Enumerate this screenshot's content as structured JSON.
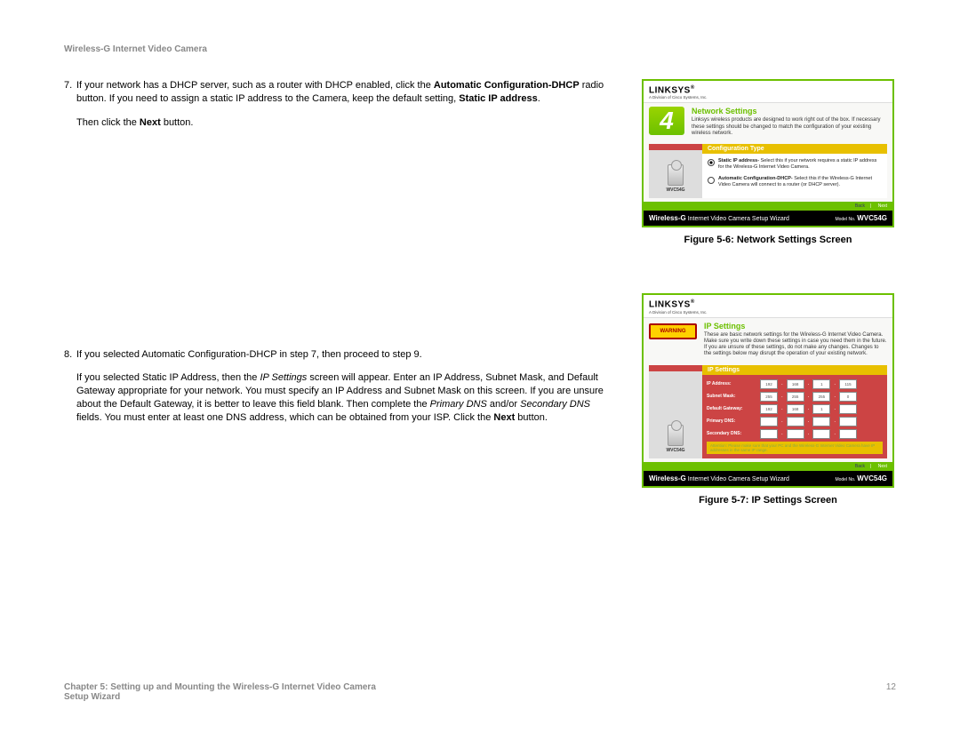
{
  "header": "Wireless-G Internet Video Camera",
  "steps": {
    "s7": {
      "num": "7.",
      "line1_a": "If your network has a DHCP server, such as a router with DHCP enabled, click the ",
      "line1_b": "Automatic Configuration-DHCP",
      "line1_c": " radio button. If you need to assign a static IP address to the Camera, keep the default setting, ",
      "line1_d": "Static IP address",
      "line1_e": ".",
      "line2_a": "Then click the ",
      "line2_b": "Next",
      "line2_c": " button."
    },
    "s8": {
      "num": "8.",
      "line1": "If you selected Automatic Configuration-DHCP in step 7, then proceed to step 9.",
      "line2_a": "If you selected Static IP Address, then the ",
      "line2_b": "IP Settings",
      "line2_c": " screen will appear. Enter an IP Address, Subnet Mask, and Default Gateway appropriate for your network. You must specify an IP Address and Subnet Mask on this screen. If you are unsure about the Default Gateway, it is better to leave this field blank. Then complete the ",
      "line2_d": "Primary DNS",
      "line2_e": " and/or ",
      "line2_f": "Secondary DNS",
      "line2_g": " fields. You must enter at least one DNS address, which can be obtained from your ISP. Click the ",
      "line2_h": "Next",
      "line2_i": " button."
    }
  },
  "figures": {
    "f6": {
      "brand": "LINKSYS",
      "brand_sub": "A Division of Cisco Systems, Inc.",
      "step_num": "4",
      "title": "Network Settings",
      "desc": "Linksys wireless products are designed to work right out of the box. If necessary these settings should be changed to match the configuration of your existing wireless network.",
      "panel_left_label_top": "Camera",
      "panel_right_header": "Configuration Type",
      "radio1": "Static IP address- Select this if your network requires a static IP address for the Wireless-G Internet Video Camera.",
      "radio2": "Automatic Configuration-DHCP- Select this if the Wireless-G Internet Video Camera will connect to a router (or DHCP server).",
      "model_label": "WVC54G",
      "nav_back": "Back",
      "nav_next": "Next",
      "footer_left": "Wireless-G",
      "footer_mid": "Internet Video Camera Setup Wizard",
      "footer_mn": "Model No.",
      "caption": "Figure 5-6: Network Settings Screen"
    },
    "f7": {
      "brand": "LINKSYS",
      "brand_sub": "A Division of Cisco Systems, Inc.",
      "warning": "WARNING",
      "title": "IP Settings",
      "desc": "These are basic network settings for the Wireless-G Internet Video Camera. Make sure you write down these settings in case you need them in the future. If you are unsure of these settings, do not make any changes. Changes to the settings below may disrupt the operation of your existing network.",
      "panel_right_header": "IP Settings",
      "rows": {
        "ip": "IP Address:",
        "mask": "Subnet Mask:",
        "gw": "Default Gateway:",
        "pdns": "Primary DNS:",
        "sdns": "Secondary DNS:"
      },
      "ip_vals": [
        "192",
        "168",
        "1",
        "115"
      ],
      "mask_vals": [
        "255",
        "255",
        "255",
        "0"
      ],
      "gw_vals": [
        "192",
        "168",
        "1",
        ""
      ],
      "model_label": "WVC54G",
      "nav_back": "Back",
      "nav_next": "Next",
      "footer_left": "Wireless-G",
      "footer_mid": "Internet Video Camera Setup Wizard",
      "footer_mn": "Model No.",
      "caption": "Figure 5-7: IP Settings Screen"
    }
  },
  "footer": {
    "chapter": "Chapter 5: Setting up and Mounting the Wireless-G Internet Video Camera",
    "section": "Setup Wizard",
    "page_no": "12"
  }
}
